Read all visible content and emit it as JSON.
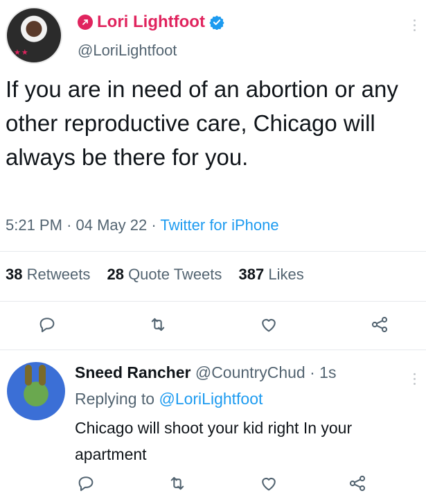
{
  "tweet": {
    "display_name": "Lori Lightfoot",
    "handle": "@LoriLightfoot",
    "text": "If you are in need of an abortion or any other reproductive care, Chicago will always be there for you.",
    "time": "5:21 PM",
    "date": "04 May 22",
    "source": "Twitter for iPhone",
    "retweets_count": "38",
    "retweets_label": "Retweets",
    "quotes_count": "28",
    "quotes_label": "Quote Tweets",
    "likes_count": "387",
    "likes_label": "Likes"
  },
  "reply": {
    "display_name": "Sneed Rancher",
    "handle": "@CountryChud",
    "time": "1s",
    "replying_prefix": "Replying to",
    "replying_to": "@LoriLightfoot",
    "text": "Chicago will shoot your kid right In your apartment"
  },
  "colors": {
    "name_pink": "#e0245e",
    "link_blue": "#1d9bf0",
    "muted": "#536471",
    "text": "#0f1419"
  },
  "icons": [
    "pin-icon",
    "verified-icon",
    "reply-icon",
    "retweet-icon",
    "like-icon",
    "share-icon",
    "more-icon"
  ]
}
